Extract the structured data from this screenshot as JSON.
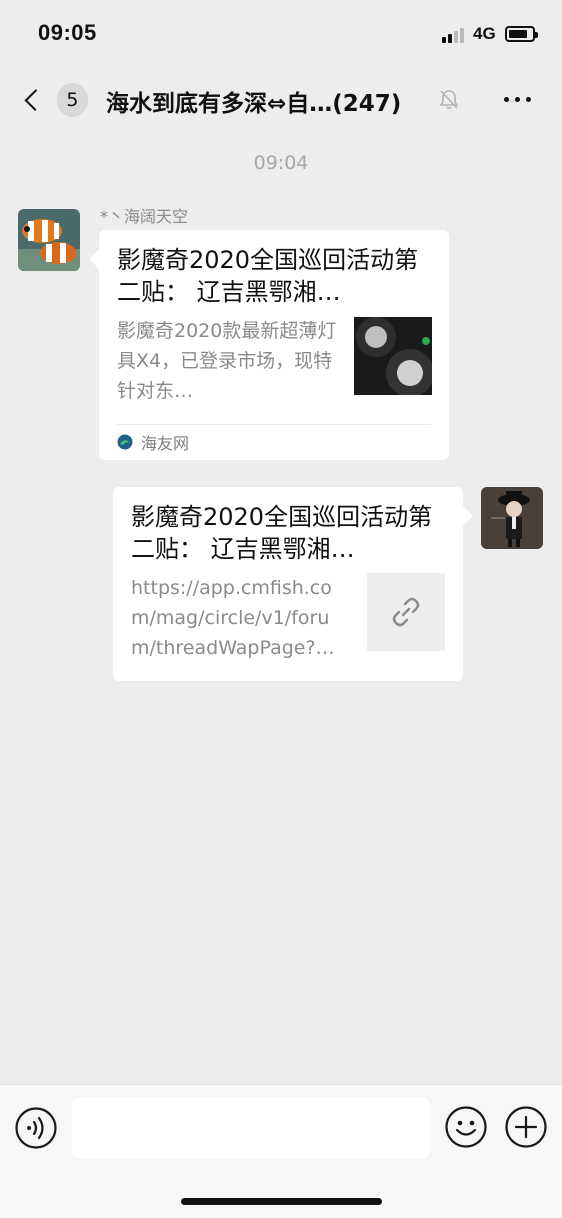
{
  "status_bar": {
    "time": "09:05",
    "network": "4G"
  },
  "nav": {
    "unread_count": "5",
    "title": "海水到底有多深⇔自…(247)",
    "icons": [
      "back-chevron-icon",
      "mute-bell-icon",
      "more-dots-icon"
    ]
  },
  "messages": {
    "timestamp": "09:04",
    "incoming": {
      "sender": "*丶海阔天空",
      "title": "影魔奇2020全国巡回活动第二贴： 辽吉黑鄂湘…",
      "description": "影魔奇2020款最新超薄灯具X4，已登录市场，现特针对东…",
      "source": "海友网"
    },
    "outgoing": {
      "title": "影魔奇2020全国巡回活动第二贴： 辽吉黑鄂湘…",
      "url": "https://app.cmfish.com/mag/circle/v1/forum/threadWapPage?…"
    }
  },
  "input_bar": {
    "icons": [
      "voice-icon",
      "emoji-icon",
      "plus-icon"
    ],
    "placeholder": ""
  },
  "colors": {
    "background": "#ededed",
    "bubble": "#ffffff",
    "secondary_text": "#8a8a8a"
  }
}
